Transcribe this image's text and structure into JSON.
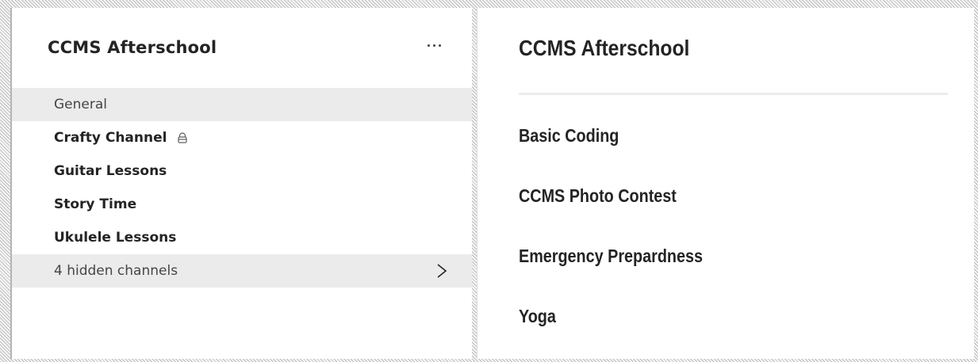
{
  "left_panel": {
    "team_name": "CCMS Afterschool",
    "more_options_icon": "more-horizontal-icon",
    "channels": [
      {
        "label": "General"
      },
      {
        "label": "Crafty Channel",
        "icon": "lock-icon"
      },
      {
        "label": "Guitar Lessons"
      },
      {
        "label": "Story Time"
      },
      {
        "label": "Ukulele Lessons"
      }
    ],
    "hidden_channels": {
      "label": "4 hidden channels",
      "icon": "chevron-right-icon"
    }
  },
  "right_panel": {
    "title": "CCMS Afterschool",
    "channels": [
      {
        "label": "Basic Coding"
      },
      {
        "label": "CCMS Photo Contest"
      },
      {
        "label": "Emergency Prepardness"
      },
      {
        "label": "Yoga"
      }
    ]
  },
  "colors": {
    "text": "#252423",
    "selected_bg": "#ebebeb",
    "muted_text": "#484644"
  }
}
